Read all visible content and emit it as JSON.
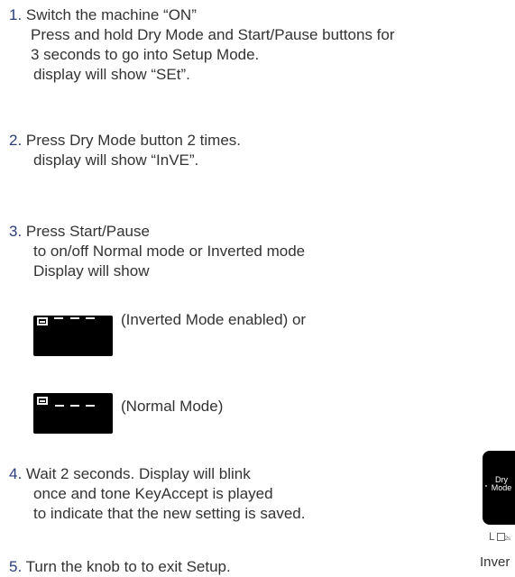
{
  "steps": [
    {
      "number": "1.",
      "lines": [
        "Switch the machine “ON”",
        "Press and hold Dry Mode and Start/Pause buttons for",
        "3 seconds to go into Setup Mode.",
        "display will show “SEt”."
      ]
    },
    {
      "number": "2.",
      "lines": [
        "Press Dry Mode button 2 times.",
        "display will show “InVE”."
      ]
    },
    {
      "number": "3.",
      "lines": [
        "Press Start/Pause",
        "to on/off Normal mode or Inverted mode",
        "Display will show"
      ]
    },
    {
      "number": "4.",
      "lines": [
        "Wait 2 seconds. Display will blink",
        "once and tone KeyAccept is played",
        "to indicate that the new setting is saved."
      ]
    },
    {
      "number": "5.",
      "lines": [
        "Turn the knob to to exit Setup."
      ]
    }
  ],
  "displays": {
    "inverted_caption": "(Inverted Mode enabled) or",
    "normal_caption": "(Normal Mode)"
  },
  "side_panel": {
    "button_label": "Dry Mode",
    "l_label": "L",
    "hold_label": "2s",
    "cut_text": "Inver"
  },
  "colors": {
    "number_color": "#2c3c7a",
    "text_color": "#333333",
    "display_bg": "#000000",
    "segment_color": "#f2f2f2"
  }
}
